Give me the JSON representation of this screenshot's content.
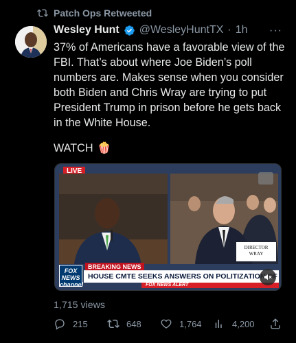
{
  "retweet": {
    "label": "Patch Ops Retweeted",
    "icon": "retweet-icon"
  },
  "tweet": {
    "author_name": "Wesley Hunt",
    "handle": "@WesleyHuntTX",
    "separator": "·",
    "time": "1h",
    "more": "···",
    "text": "37% of Americans have a favorable view of the FBI.  That’s about where Joe Biden’s poll numbers are.  Makes sense when you consider both Biden and Chris Wray are trying to put President Trump in prison before he gets back in the White House.",
    "watch_label": "WATCH",
    "watch_emoji": "🍿"
  },
  "media": {
    "live_label": "LIVE",
    "nameplate": "DIRECTOR\nWRAY",
    "breaking_label": "BREAKING NEWS",
    "network_logo": "FOX\nNEWS\nchannel",
    "headline": "HOUSE CMTE SEEKS ANSWERS ON POLITIZATION OF FBI",
    "alert_label": "FOX NEWS ALERT"
  },
  "stats": {
    "views": "1,715 views",
    "replies": "215",
    "retweets": "648",
    "likes": "1,764",
    "analytics": "4,200"
  },
  "colors": {
    "background": "#000000",
    "text": "#e7e9ea",
    "muted": "#8b98a5",
    "verified": "#1d9bf0",
    "fox_red": "#d61f26"
  }
}
